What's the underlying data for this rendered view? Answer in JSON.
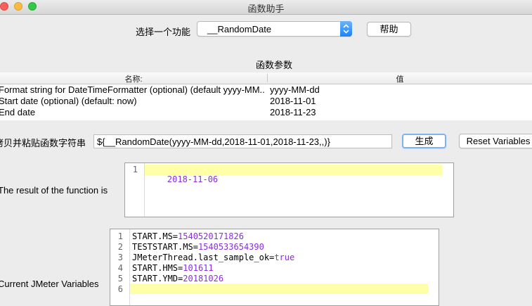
{
  "window": {
    "title": "函数助手"
  },
  "function_select": {
    "label": "选择一个功能",
    "value": "__RandomDate",
    "help_label": "帮助"
  },
  "params": {
    "section_title": "函数参数",
    "headers": [
      "名称:",
      "值"
    ],
    "rows": [
      {
        "name": "Format string for DateTimeFormatter (optional) (default yyyy-MM...",
        "value": "yyyy-MM-dd"
      },
      {
        "name": "Start date (optional) (default: now)",
        "value": "2018-11-01"
      },
      {
        "name": "End date",
        "value": "2018-11-23"
      }
    ]
  },
  "copy_paste": {
    "label": "拷贝并粘贴函数字符串",
    "value": "${__RandomDate(yyyy-MM-dd,2018-11-01,2018-11-23,,)}",
    "generate_label": "生成",
    "reset_label": "Reset Variables"
  },
  "result": {
    "label": "The result of the function is",
    "lines": [
      {
        "num": "1",
        "text": "2018-11-06"
      }
    ]
  },
  "variables": {
    "label": "Current JMeter Variables",
    "lines": [
      {
        "num": "1",
        "key": "START.MS",
        "val": "1540520171826"
      },
      {
        "num": "2",
        "key": "TESTSTART.MS",
        "val": "1540533654390"
      },
      {
        "num": "3",
        "key": "JMeterThread.last_sample_ok",
        "val": "true"
      },
      {
        "num": "4",
        "key": "START.HMS",
        "val": "101611"
      },
      {
        "num": "5",
        "key": "START.YMD",
        "val": "20181026"
      },
      {
        "num": "6",
        "key": "",
        "val": ""
      }
    ]
  }
}
